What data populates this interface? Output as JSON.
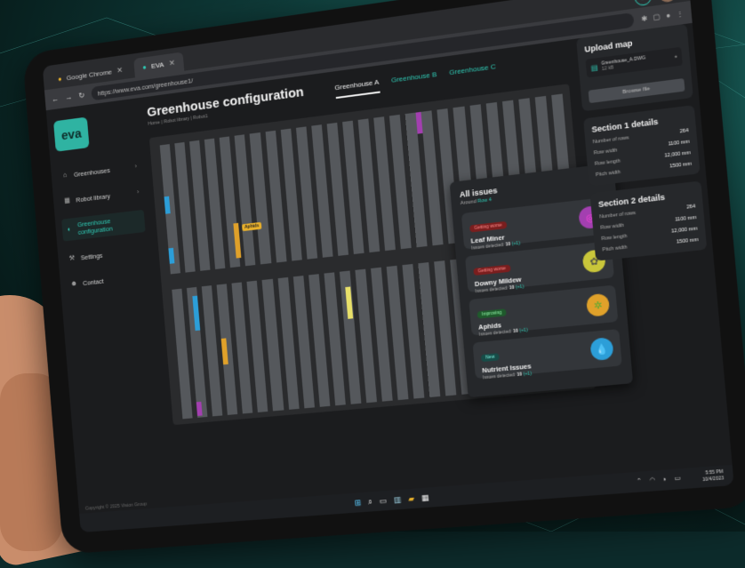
{
  "browser": {
    "tabs": [
      {
        "label": "Google Chrome"
      },
      {
        "label": "EVA"
      }
    ],
    "url": "https://www.eva.com/greenhouse1/"
  },
  "sidebar": {
    "logo": "eva",
    "items": [
      {
        "label": "Greenhouses",
        "icon": "greenhouse-icon"
      },
      {
        "label": "Robot library",
        "icon": "grid-icon"
      },
      {
        "label": "Greenhouse configuration",
        "icon": "toggle-icon"
      },
      {
        "label": "Settings",
        "icon": "wrench-icon"
      },
      {
        "label": "Contact",
        "icon": "person-icon"
      }
    ],
    "copyright": "Copyright © 2025 Vision Group"
  },
  "header": {
    "title": "Greenhouse configuration",
    "breadcrumb": "Home | Robot library | Robot1",
    "tabs": [
      "Greenhouse A",
      "Greenhouse B",
      "Greenhouse C"
    ]
  },
  "map": {
    "tooltip": "Aphids"
  },
  "issues": {
    "title": "All issues",
    "subtitle_prefix": "Around",
    "subtitle_link": "Row 4",
    "items": [
      {
        "status": "Getting worse",
        "name": "Leaf Miner",
        "detected_label": "Issues detected:",
        "count": "10",
        "delta": "(+1)",
        "color": "#a33fb0",
        "icon": "leaf-miner-icon"
      },
      {
        "status": "Getting worse",
        "name": "Downy Mildew",
        "detected_label": "Issues detected:",
        "count": "10",
        "delta": "(+1)",
        "color": "#c9c63a",
        "icon": "mildew-icon"
      },
      {
        "status": "Improving",
        "name": "Aphids",
        "detected_label": "Issues detected:",
        "count": "10",
        "delta": "(+1)",
        "color": "#e0a12a",
        "icon": "bug-icon"
      },
      {
        "status": "New",
        "name": "Nutrient Issues",
        "detected_label": "Issues detected:",
        "count": "10",
        "delta": "(+1)",
        "color": "#2c9ed8",
        "icon": "drop-icon"
      }
    ]
  },
  "upload": {
    "title": "Upload map",
    "file_name": "Greenhouse_A.DWG",
    "file_size": "12 kB",
    "button": "Browse file"
  },
  "section1": {
    "title": "Section 1 details",
    "rows": [
      {
        "k": "Number of rows",
        "v": "264"
      },
      {
        "k": "Row width",
        "v": "1100 mm"
      },
      {
        "k": "Row length",
        "v": "12,000 mm"
      },
      {
        "k": "Pitch width",
        "v": "1500 mm"
      }
    ]
  },
  "section2": {
    "title": "Section 2 details",
    "rows": [
      {
        "k": "Number of rows",
        "v": "264"
      },
      {
        "k": "Row width",
        "v": "1100 mm"
      },
      {
        "k": "Row length",
        "v": "12,000 mm"
      },
      {
        "k": "Pitch width",
        "v": "1500 mm"
      }
    ]
  },
  "taskbar": {
    "time": "5:55 PM",
    "date": "10/4/2023"
  }
}
